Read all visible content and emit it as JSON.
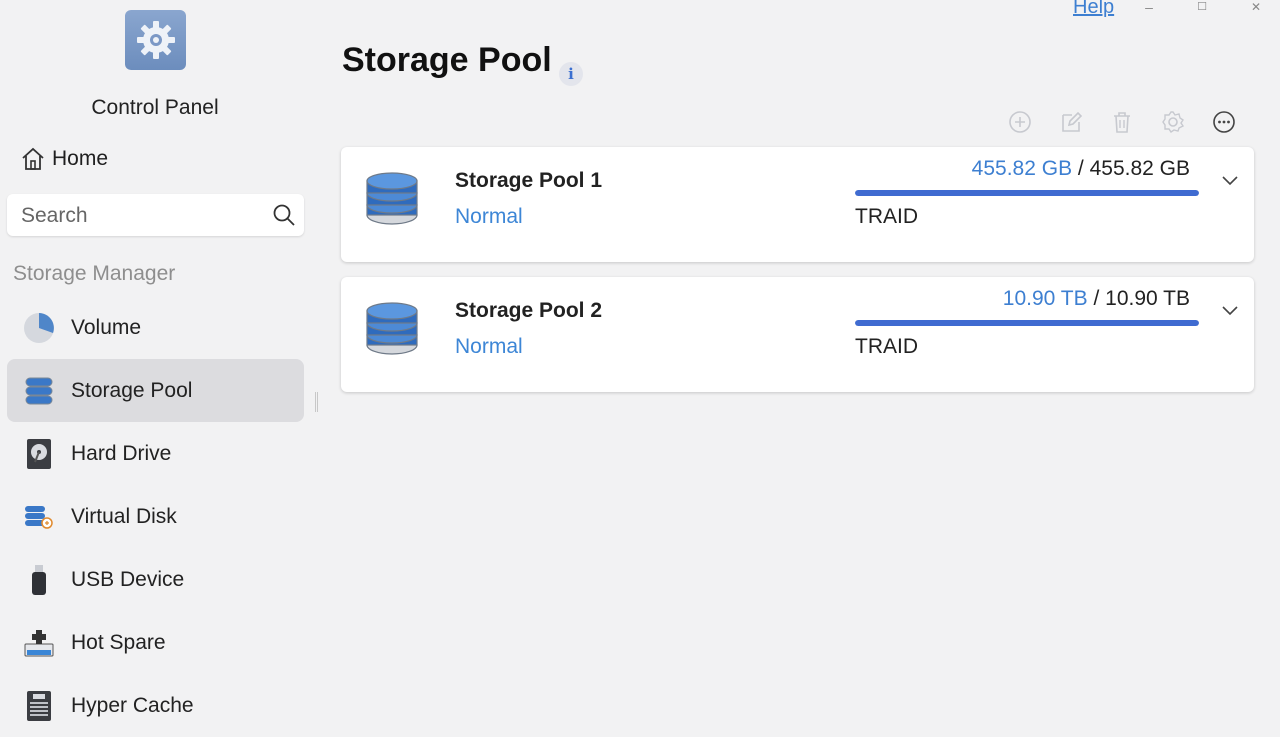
{
  "window": {
    "help_label": "Help",
    "minimize_glyph": "–",
    "maximize_glyph": "☐",
    "close_glyph": "✕"
  },
  "sidebar": {
    "app_title": "Control Panel",
    "home_label": "Home",
    "search_placeholder": "Search",
    "section_title": "Storage Manager",
    "items": [
      {
        "label": "Volume",
        "icon": "pie-chart-icon"
      },
      {
        "label": "Storage Pool",
        "icon": "database-icon",
        "active": true
      },
      {
        "label": "Hard Drive",
        "icon": "hard-drive-icon"
      },
      {
        "label": "Virtual Disk",
        "icon": "virtual-disk-icon"
      },
      {
        "label": "USB Device",
        "icon": "usb-icon"
      },
      {
        "label": "Hot Spare",
        "icon": "hot-spare-icon"
      },
      {
        "label": "Hyper Cache",
        "icon": "ssd-icon"
      }
    ]
  },
  "main": {
    "title": "Storage Pool",
    "info_glyph": "i",
    "toolbar": [
      "add-icon",
      "edit-icon",
      "delete-icon",
      "settings-icon",
      "more-icon"
    ],
    "pools": [
      {
        "name": "Storage Pool 1",
        "status": "Normal",
        "used": "455.82 GB",
        "separator": " / ",
        "total": "455.82 GB",
        "raid": "TRAID",
        "usage_fraction": 1.0
      },
      {
        "name": "Storage Pool 2",
        "status": "Normal",
        "used": "10.90 TB",
        "separator": " / ",
        "total": "10.90 TB",
        "raid": "TRAID",
        "usage_fraction": 1.0
      }
    ]
  },
  "colors": {
    "accent": "#3d7fd1",
    "bar": "#3f6bd1",
    "status": "#3d86d6"
  }
}
